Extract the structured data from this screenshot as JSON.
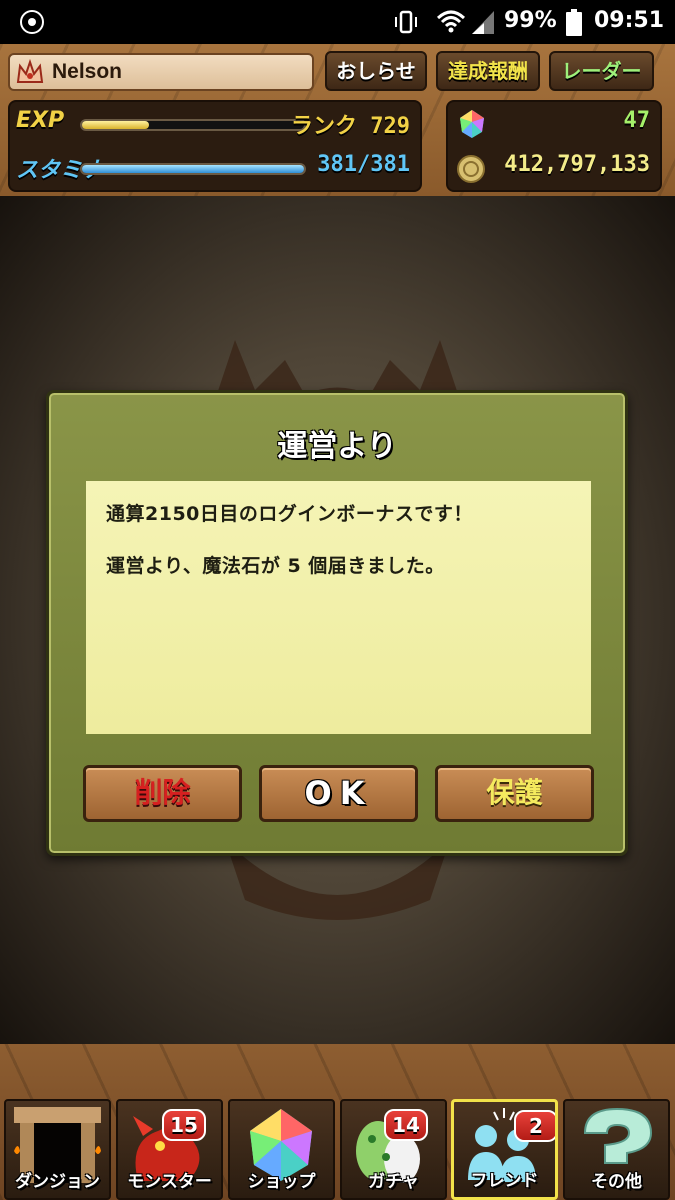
{
  "status_bar": {
    "battery_percent": "99%",
    "time": "09:51"
  },
  "hud": {
    "player_name": "Nelson",
    "buttons": {
      "news": "おしらせ",
      "achievements": "達成報酬",
      "radar": "レーダー"
    },
    "exp": {
      "label": "EXP",
      "rank_text": "ランク 729",
      "progress": 0.3
    },
    "stamina": {
      "label": "スタミナ",
      "value_text": "381/381",
      "progress": 1.0
    },
    "magic_stones": "47",
    "coins": "412,797,133"
  },
  "dialog": {
    "title": "運営より",
    "message_line_1": "通算2150日目のログインボーナスです！",
    "message_line_2": "運営より、魔法石が 5 個届きました。",
    "buttons": {
      "delete": "削除",
      "ok": "OK",
      "protect": "保護"
    }
  },
  "bottom_nav": {
    "items": [
      {
        "label": "ダンジョン",
        "badge": ""
      },
      {
        "label": "モンスター",
        "badge": "15"
      },
      {
        "label": "ショップ",
        "badge": ""
      },
      {
        "label": "ガチャ",
        "badge": "14"
      },
      {
        "label": "フレンド",
        "badge": "2",
        "active": true
      },
      {
        "label": "その他",
        "badge": ""
      }
    ]
  },
  "colors": {
    "exp_yellow": "#f2d246",
    "stamina_blue": "#60c6f6",
    "stone_green": "#a6f06a",
    "dialog_green": "#7c8840",
    "delete_red": "#d62020",
    "protect_yellow": "#f5ea5e"
  }
}
